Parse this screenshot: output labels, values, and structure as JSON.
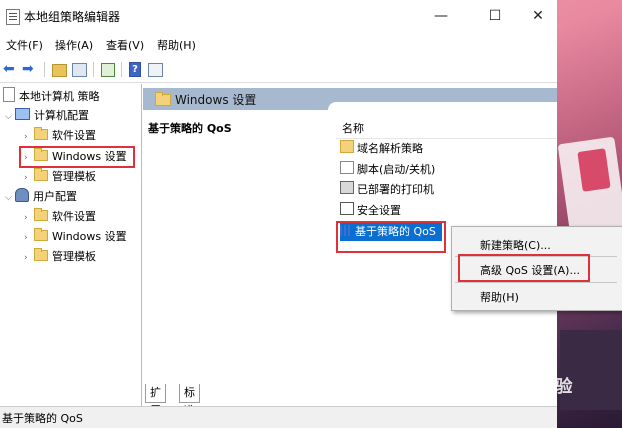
{
  "window": {
    "title": "本地组策略编辑器"
  },
  "window_controls": {
    "minimize": "—",
    "maximize": "☐",
    "close": "✕"
  },
  "menu": {
    "items": [
      "文件(F)",
      "操作(A)",
      "查看(V)",
      "帮助(H)"
    ]
  },
  "toolbar": {
    "back": "⬅",
    "forward": "➡",
    "help": "?"
  },
  "tree": {
    "root": "本地计算机 策略",
    "computer_config": "计算机配置",
    "computer_children": [
      "软件设置",
      "Windows 设置",
      "管理模板"
    ],
    "user_config": "用户配置",
    "user_children": [
      "软件设置",
      "Windows 设置",
      "管理模板"
    ]
  },
  "main": {
    "header": "Windows 设置",
    "description_title": "基于策略的 QoS",
    "column_name": "名称",
    "items": [
      "域名解析策略",
      "脚本(启动/关机)",
      "已部署的打印机",
      "安全设置",
      "基于策略的 QoS"
    ]
  },
  "context_menu": {
    "items": [
      "新建策略(C)...",
      "高级 QoS 设置(A)...",
      "帮助(H)"
    ]
  },
  "tabs": [
    "扩展",
    "标准"
  ],
  "status": {
    "text": "基于策略的 QoS"
  },
  "watermark": "Baidu 经验",
  "colors": {
    "selection": "#0b6fd1",
    "highlight_box": "#e0303a",
    "header_bar": "#a7b9cf"
  }
}
